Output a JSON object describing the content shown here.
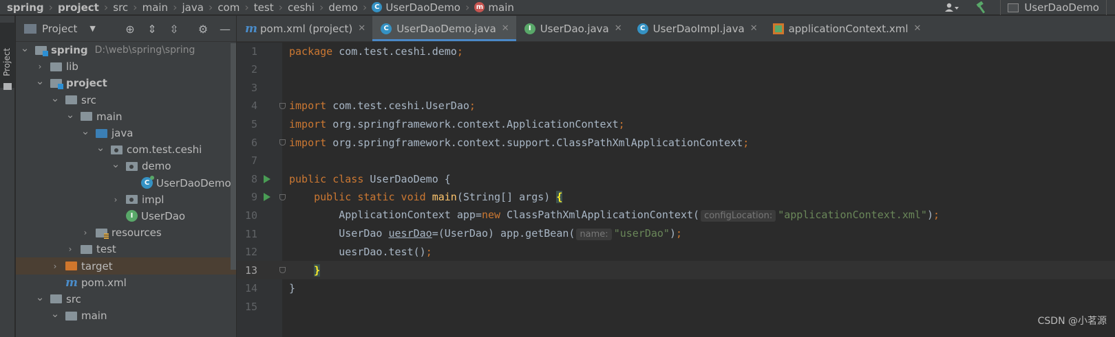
{
  "navbar": {
    "breadcrumbs": [
      "spring",
      "project",
      "src",
      "main",
      "java",
      "com",
      "test",
      "ceshi",
      "demo",
      "UserDaoDemo",
      "main"
    ],
    "breadcrumb_icons": {
      "class_icon_letter": "C",
      "method_icon_letter": "m"
    },
    "run_config": "UserDaoDemo"
  },
  "tool_strip": {
    "project_label": "Project"
  },
  "project_panel": {
    "title": "Project",
    "tree": [
      {
        "label": "spring",
        "path": "D:\\web\\spring\\spring",
        "depth": 0,
        "arrow": "down",
        "icon": "module-folder-icon",
        "bold": true
      },
      {
        "label": "lib",
        "depth": 1,
        "arrow": "right",
        "icon": "folder-icon"
      },
      {
        "label": "project",
        "depth": 1,
        "arrow": "down",
        "icon": "module-folder-icon",
        "bold": true
      },
      {
        "label": "src",
        "depth": 2,
        "arrow": "down",
        "icon": "folder-icon"
      },
      {
        "label": "main",
        "depth": 3,
        "arrow": "down",
        "icon": "folder-icon"
      },
      {
        "label": "java",
        "depth": 4,
        "arrow": "down",
        "icon": "source-folder-icon"
      },
      {
        "label": "com.test.ceshi",
        "depth": 5,
        "arrow": "down",
        "icon": "package-icon"
      },
      {
        "label": "demo",
        "depth": 6,
        "arrow": "down",
        "icon": "package-icon"
      },
      {
        "label": "UserDaoDemo",
        "depth": 7,
        "arrow": "none",
        "icon": "class-file-icon"
      },
      {
        "label": "impl",
        "depth": 6,
        "arrow": "right",
        "icon": "package-icon"
      },
      {
        "label": "UserDao",
        "depth": 6,
        "arrow": "none",
        "icon": "interface-file-icon"
      },
      {
        "label": "resources",
        "depth": 4,
        "arrow": "right",
        "icon": "resources-folder-icon"
      },
      {
        "label": "test",
        "depth": 3,
        "arrow": "right",
        "icon": "folder-icon"
      },
      {
        "label": "target",
        "depth": 2,
        "arrow": "right",
        "icon": "excluded-folder-icon",
        "selected": true
      },
      {
        "label": "pom.xml",
        "depth": 2,
        "arrow": "none",
        "icon": "maven-pom-icon"
      },
      {
        "label": "src",
        "depth": 1,
        "arrow": "down",
        "icon": "folder-icon"
      },
      {
        "label": "main",
        "depth": 2,
        "arrow": "down",
        "icon": "folder-icon"
      }
    ]
  },
  "tabs": [
    {
      "label": "pom.xml (project)",
      "icon": "maven-pom-icon",
      "active": false
    },
    {
      "label": "UserDaoDemo.java",
      "icon": "class-file-icon",
      "active": true
    },
    {
      "label": "UserDao.java",
      "icon": "interface-file-icon",
      "active": false
    },
    {
      "label": "UserDaoImpl.java",
      "icon": "class-file-icon",
      "active": false
    },
    {
      "label": "applicationContext.xml",
      "icon": "spring-xml-icon",
      "active": false
    }
  ],
  "editor": {
    "current_line": 13,
    "lines": [
      {
        "n": "1",
        "tokens": [
          [
            "kw",
            "package "
          ],
          [
            "",
            "com.test.ceshi.demo"
          ],
          [
            "kw",
            ";"
          ]
        ]
      },
      {
        "n": "2",
        "tokens": []
      },
      {
        "n": "3",
        "tokens": []
      },
      {
        "n": "4",
        "tokens": [
          [
            "kw",
            "import "
          ],
          [
            "",
            "com.test.ceshi.UserDao"
          ],
          [
            "kw",
            ";"
          ]
        ],
        "fold": true
      },
      {
        "n": "5",
        "tokens": [
          [
            "kw",
            "import "
          ],
          [
            "",
            "org.springframework.context.ApplicationContext"
          ],
          [
            "kw",
            ";"
          ]
        ]
      },
      {
        "n": "6",
        "tokens": [
          [
            "kw",
            "import "
          ],
          [
            "",
            "org.springframework.context.support.ClassPathXmlApplicationContext"
          ],
          [
            "kw",
            ";"
          ]
        ],
        "fold": true
      },
      {
        "n": "7",
        "tokens": []
      },
      {
        "n": "8",
        "tokens": [
          [
            "kw",
            "public class "
          ],
          [
            "",
            "UserDaoDemo {"
          ]
        ],
        "run": true
      },
      {
        "n": "9",
        "tokens": [
          [
            "",
            "    "
          ],
          [
            "kw",
            "public static void "
          ],
          [
            "fn",
            "main"
          ],
          [
            "",
            "(String[] args) "
          ],
          [
            "brace",
            "{"
          ]
        ],
        "run": true,
        "fold": true
      },
      {
        "n": "10",
        "tokens": [
          [
            "",
            "        ApplicationContext app="
          ],
          [
            "kw",
            "new "
          ],
          [
            "",
            "ClassPathXmlApplicationContext("
          ],
          [
            "hint",
            "configLocation:"
          ],
          [
            "str",
            "\"applicationContext.xml\""
          ],
          [
            "",
            ")"
          ],
          [
            "kw",
            ";"
          ]
        ]
      },
      {
        "n": "11",
        "tokens": [
          [
            "",
            "        UserDao "
          ],
          [
            "ul",
            "uesrDao"
          ],
          [
            "",
            "=(UserDao) app.getBean("
          ],
          [
            "hint",
            "name:"
          ],
          [
            "str",
            "\"userDao\""
          ],
          [
            "",
            ")"
          ],
          [
            "kw",
            ";"
          ]
        ]
      },
      {
        "n": "12",
        "tokens": [
          [
            "",
            "        uesrDao.test()"
          ],
          [
            "kw",
            ";"
          ]
        ]
      },
      {
        "n": "13",
        "tokens": [
          [
            "",
            "    "
          ],
          [
            "brace",
            "}"
          ]
        ],
        "fold": true
      },
      {
        "n": "14",
        "tokens": [
          [
            "",
            "}"
          ]
        ]
      },
      {
        "n": "15",
        "tokens": []
      }
    ]
  },
  "watermark": "CSDN @小茗源",
  "colors": {
    "keyword": "#cc7832",
    "method": "#ffc66d",
    "string": "#6a8759",
    "text": "#a9b7c6",
    "accent": "#4a88c7"
  }
}
